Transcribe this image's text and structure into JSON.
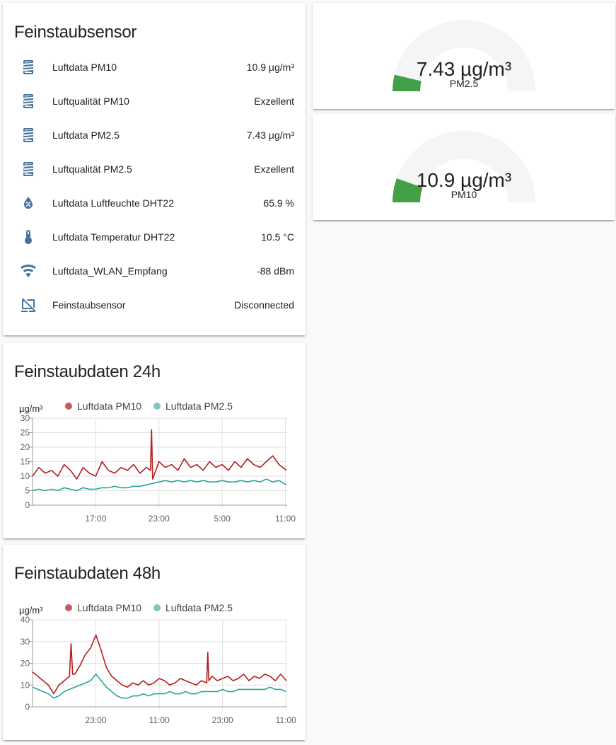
{
  "entities_card": {
    "title": "Feinstaubsensor",
    "rows": [
      {
        "icon": "air-filter-icon",
        "name": "Luftdata PM10",
        "state": "10.9 µg/m³"
      },
      {
        "icon": "air-filter-icon",
        "name": "Luftqualität PM10",
        "state": "Exzellent"
      },
      {
        "icon": "air-filter-icon",
        "name": "Luftdata PM2.5",
        "state": "7.43 µg/m³"
      },
      {
        "icon": "air-filter-icon",
        "name": "Luftqualität PM2.5",
        "state": "Exzellent"
      },
      {
        "icon": "water-percent-icon",
        "name": "Luftdata Luftfeuchte DHT22",
        "state": "65.9 %"
      },
      {
        "icon": "thermometer-icon",
        "name": "Luftdata Temperatur DHT22",
        "state": "10.5 °C"
      },
      {
        "icon": "wifi-icon",
        "name": "Luftdata_WLAN_Empfang",
        "state": "-88 dBm"
      },
      {
        "icon": "lan-disconnect-icon",
        "name": "Feinstaubsensor",
        "state": "Disconnected"
      }
    ],
    "icon_color": "#44739e"
  },
  "gauges": [
    {
      "value_text": "7.43 µg/m³",
      "name": "PM2.5",
      "value": 7.43,
      "min": 0,
      "max": 100,
      "color": "#43a047"
    },
    {
      "value_text": "10.9 µg/m³",
      "name": "PM10",
      "value": 10.9,
      "min": 0,
      "max": 100,
      "color": "#43a047"
    }
  ],
  "colors": {
    "pm10": "#b71c1c",
    "pm10_legend": "#c75b5f",
    "pm25": "#26a69a",
    "pm25_legend": "#7fc6c0",
    "gauge_track": "#f5f5f5",
    "grid": "#e0e0e0"
  },
  "chart_data": [
    {
      "type": "line",
      "title": "Feinstaubdaten 24h",
      "ylabel": "µg/m³",
      "ylim": [
        0,
        30
      ],
      "yticks": [
        "0",
        "5",
        "10",
        "15",
        "20",
        "25",
        "30"
      ],
      "xlim_hours": [
        11,
        35.1
      ],
      "xticks": [
        {
          "label": "17:00",
          "hour": 17
        },
        {
          "label": "23:00",
          "hour": 23
        },
        {
          "label": "5:00",
          "hour": 29
        },
        {
          "label": "11:00",
          "hour": 35
        }
      ],
      "grid": true,
      "legend": "top-left",
      "series": [
        {
          "name": "Luftdata PM10",
          "color": "#b71c1c",
          "x": [
            11,
            11.6,
            12.2,
            12.8,
            13.4,
            14,
            14.6,
            15.2,
            15.8,
            16.4,
            17,
            17.6,
            18.2,
            18.8,
            19.4,
            20,
            20.6,
            21.2,
            21.8,
            22.2,
            22.3,
            22.4,
            23,
            23.6,
            24.2,
            24.8,
            25.4,
            26,
            26.6,
            27.2,
            27.8,
            28.4,
            29,
            29.6,
            30.2,
            30.8,
            31.4,
            32,
            32.6,
            33.2,
            33.8,
            34.4,
            35.1
          ],
          "y": [
            10,
            13,
            11,
            12,
            10,
            14,
            12,
            9,
            13,
            11,
            10,
            15,
            12,
            11,
            13,
            12,
            14,
            11,
            13,
            12,
            26,
            9,
            15,
            13,
            14,
            12,
            16,
            13,
            14,
            12,
            15,
            13,
            14,
            12,
            15,
            13,
            16,
            14,
            13,
            15,
            17,
            14,
            12
          ]
        },
        {
          "name": "Luftdata PM2.5",
          "color": "#26a69a",
          "x": [
            11,
            11.6,
            12.2,
            12.8,
            13.4,
            14,
            14.6,
            15.2,
            15.8,
            16.4,
            17,
            17.6,
            18.2,
            18.8,
            19.4,
            20,
            20.6,
            21.2,
            21.8,
            22.4,
            23,
            23.6,
            24.2,
            24.8,
            25.4,
            26,
            26.6,
            27.2,
            27.8,
            28.4,
            29,
            29.6,
            30.2,
            30.8,
            31.4,
            32,
            32.6,
            33.2,
            33.8,
            34.4,
            35.1
          ],
          "y": [
            5,
            5.5,
            5,
            5.5,
            5,
            6,
            5.5,
            5,
            6,
            5.5,
            5.5,
            6,
            6,
            6.5,
            6,
            6,
            6.5,
            6.5,
            7,
            7.5,
            8,
            8.5,
            8,
            8.5,
            8,
            8.5,
            8,
            8.5,
            8,
            8,
            8.5,
            8,
            8,
            8.5,
            8,
            8.5,
            8,
            9,
            8,
            8.5,
            7
          ]
        }
      ]
    },
    {
      "type": "line",
      "title": "Feinstaubdaten 48h",
      "ylabel": "µg/m³",
      "ylim": [
        0,
        40
      ],
      "yticks": [
        "0",
        "10",
        "20",
        "30",
        "40"
      ],
      "xlim_hours": [
        11,
        59.1
      ],
      "xticks": [
        {
          "label": "23:00",
          "hour": 23
        },
        {
          "label": "11:00",
          "hour": 35
        },
        {
          "label": "23:00",
          "hour": 47
        },
        {
          "label": "11:00",
          "hour": 59
        }
      ],
      "grid": true,
      "legend": "top-left",
      "series": [
        {
          "name": "Luftdata PM10",
          "color": "#b71c1c",
          "x": [
            11,
            12,
            13,
            14,
            15,
            16,
            17,
            18,
            18.3,
            18.6,
            19,
            20,
            21,
            22,
            23,
            24,
            25,
            26,
            27,
            28,
            29,
            30,
            31,
            32,
            33,
            34,
            35,
            36,
            37,
            38,
            39,
            40,
            41,
            42,
            43,
            44,
            44.2,
            44.4,
            45,
            46,
            47,
            48,
            49,
            50,
            51,
            52,
            53,
            54,
            55,
            56,
            57,
            58,
            59.1
          ],
          "y": [
            16,
            14,
            12,
            10,
            6,
            10,
            12,
            14,
            29,
            15,
            15,
            19,
            24,
            27,
            33,
            26,
            18,
            14,
            12,
            10,
            9,
            11,
            10,
            12,
            10,
            11,
            13,
            12,
            10,
            11,
            13,
            12,
            11,
            10,
            12,
            11,
            25,
            12,
            14,
            12,
            13,
            14,
            12,
            13,
            15,
            12,
            14,
            13,
            15,
            14,
            12,
            15,
            12
          ]
        },
        {
          "name": "Luftdata PM2.5",
          "color": "#26a69a",
          "x": [
            11,
            12,
            13,
            14,
            15,
            16,
            17,
            18,
            19,
            20,
            21,
            22,
            23,
            24,
            25,
            26,
            27,
            28,
            29,
            30,
            31,
            32,
            33,
            34,
            35,
            36,
            37,
            38,
            39,
            40,
            41,
            42,
            43,
            44,
            45,
            46,
            47,
            48,
            49,
            50,
            51,
            52,
            53,
            54,
            55,
            56,
            57,
            58,
            59.1
          ],
          "y": [
            9,
            8,
            7,
            6,
            4,
            5,
            7,
            8,
            9,
            10,
            11,
            12,
            15,
            12,
            9,
            7,
            5,
            4,
            4,
            5,
            5,
            6,
            5,
            6,
            6,
            6,
            7,
            6,
            6,
            7,
            6,
            6,
            7,
            7,
            7,
            7,
            8,
            7,
            7,
            8,
            8,
            8,
            8,
            8,
            8,
            9,
            8,
            8,
            7
          ]
        }
      ]
    }
  ]
}
